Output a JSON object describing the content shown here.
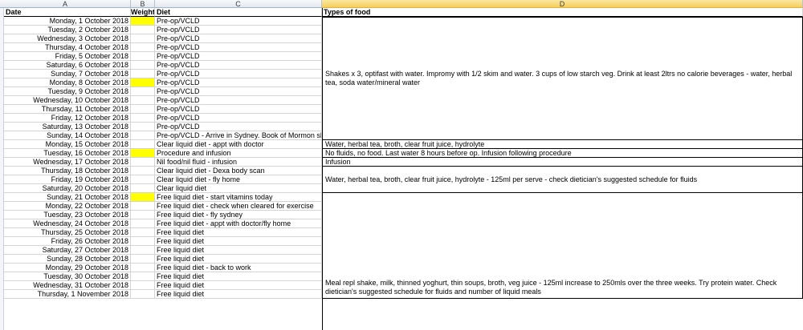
{
  "columns": {
    "a": "A",
    "b": "B",
    "c": "C",
    "d": "D"
  },
  "header": {
    "date": "Date",
    "weight": "Weight",
    "diet": "Diet",
    "types": "Types of food"
  },
  "rows": [
    {
      "date": "Monday, 1 October 2018",
      "diet": "Pre-op/VCLD",
      "weight_highlight": true
    },
    {
      "date": "Tuesday, 2 October 2018",
      "diet": "Pre-op/VCLD"
    },
    {
      "date": "Wednesday, 3 October 2018",
      "diet": "Pre-op/VCLD"
    },
    {
      "date": "Thursday, 4 October 2018",
      "diet": "Pre-op/VCLD"
    },
    {
      "date": "Friday, 5 October 2018",
      "diet": "Pre-op/VCLD"
    },
    {
      "date": "Saturday, 6 October 2018",
      "diet": "Pre-op/VCLD"
    },
    {
      "date": "Sunday, 7 October 2018",
      "diet": "Pre-op/VCLD"
    },
    {
      "date": "Monday, 8 October 2018",
      "diet": "Pre-op/VCLD",
      "weight_highlight": true
    },
    {
      "date": "Tuesday, 9 October 2018",
      "diet": "Pre-op/VCLD"
    },
    {
      "date": "Wednesday, 10 October 2018",
      "diet": "Pre-op/VCLD"
    },
    {
      "date": "Thursday, 11 October 2018",
      "diet": "Pre-op/VCLD"
    },
    {
      "date": "Friday, 12 October 2018",
      "diet": "Pre-op/VCLD"
    },
    {
      "date": "Saturday, 13 October 2018",
      "diet": "Pre-op/VCLD"
    },
    {
      "date": "Sunday, 14 October 2018",
      "diet": "Pre-op/VCLD - Arrive in Sydney.  Book of Mormon show"
    },
    {
      "date": "Monday, 15 October 2018",
      "diet": "Clear liquid diet - appt with doctor"
    },
    {
      "date": "Tuesday, 16 October 2018",
      "diet": "Procedure and infusion",
      "weight_highlight": true
    },
    {
      "date": "Wednesday, 17 October 2018",
      "diet": "Nil food/nil fluid - infusion"
    },
    {
      "date": "Thursday, 18 October 2018",
      "diet": "Clear liquid diet - Dexa body scan"
    },
    {
      "date": "Friday, 19 October 2018",
      "diet": "Clear liquid diet - fly home"
    },
    {
      "date": "Saturday, 20 October 2018",
      "diet": "Clear liquid diet"
    },
    {
      "date": "Sunday, 21 October 2018",
      "diet": "Free liquid diet - start vitamins today",
      "weight_highlight": true
    },
    {
      "date": "Monday, 22 October 2018",
      "diet": "Free liquid diet - check when cleared for exercise"
    },
    {
      "date": "Tuesday, 23 October 2018",
      "diet": "Free liquid diet - fly sydney"
    },
    {
      "date": "Wednesday, 24 October 2018",
      "diet": "Free liquid diet - appt with doctor/fly home"
    },
    {
      "date": "Thursday, 25 October 2018",
      "diet": "Free liquid diet"
    },
    {
      "date": "Friday, 26 October 2018",
      "diet": "Free liquid diet"
    },
    {
      "date": "Saturday, 27 October 2018",
      "diet": "Free liquid diet"
    },
    {
      "date": "Sunday, 28 October 2018",
      "diet": "Free liquid diet"
    },
    {
      "date": "Monday, 29 October 2018",
      "diet": "Free liquid diet - back to work"
    },
    {
      "date": "Tuesday, 30 October 2018",
      "diet": "Free liquid diet"
    },
    {
      "date": "Wednesday, 31 October 2018",
      "diet": "Free liquid diet"
    },
    {
      "date": "Thursday, 1 November 2018",
      "diet": "Free liquid diet"
    }
  ],
  "food_blocks": [
    {
      "first_row": 0,
      "last_row": 13,
      "text": "Shakes x 3, optifast with water. Impromy with 1/2 skim and water.  3 cups of low starch veg.  Drink at least 2ltrs no calorie beverages - water, herbal tea, soda water/mineral water"
    },
    {
      "first_row": 14,
      "last_row": 14,
      "text": "Water, herbal tea, broth, clear fruit juice, hydrolyte"
    },
    {
      "first_row": 15,
      "last_row": 15,
      "text": "No fluids, no food.  Last water 8 hours before op. Infusion following procedure"
    },
    {
      "first_row": 16,
      "last_row": 16,
      "text": "Infusion"
    },
    {
      "first_row": 17,
      "last_row": 19,
      "text": "Water, herbal tea, broth, clear fruit juice, hydrolyte - 125ml per serve - check dietician's suggested schedule for fluids"
    },
    {
      "first_row": 20,
      "last_row": 31,
      "text": "Meal repl shake, milk, thinned yoghurt, thin soups, broth, veg juice - 125ml increase to 250mls over the three weeks.  Try protein water.  Check dietician's suggested schedule for fluids and number of liquid meals"
    }
  ]
}
